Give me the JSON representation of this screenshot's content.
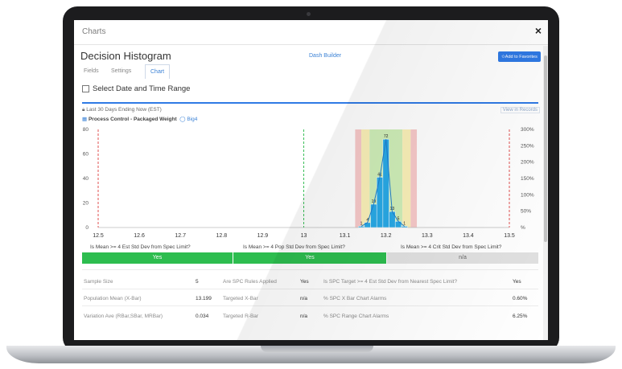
{
  "modal": {
    "title": "Charts",
    "close": "×"
  },
  "page": {
    "title": "Decision Histogram",
    "dash_builder": "Dash Builder",
    "favorites": "✩Add to Favorites"
  },
  "tabs": [
    {
      "label": "Fields"
    },
    {
      "label": "Settings"
    },
    {
      "label": "Chart"
    }
  ],
  "date_range": {
    "label": "Select Date and Time Range"
  },
  "meta": {
    "range": "Last 30 Days Ending Now (EST)",
    "source": "Process Control - Packaged Weight",
    "tag": "Big4",
    "view_records": "View in Records"
  },
  "chart_data": {
    "type": "bar",
    "x_ticks": [
      "12.5",
      "12.6",
      "12.7",
      "12.8",
      "12.9",
      "13",
      "13.1",
      "13.2",
      "13.3",
      "13.4",
      "13.5"
    ],
    "x_range": [
      12.5,
      13.5
    ],
    "y_left_ticks": [
      "0",
      "20",
      "40",
      "60",
      "80"
    ],
    "y_left_range": [
      0,
      80
    ],
    "y_right_ticks": [
      "%",
      "50%",
      "100%",
      "150%",
      "200%",
      "250%",
      "300%"
    ],
    "bars": [
      {
        "x": 13.14,
        "value": 1
      },
      {
        "x": 13.155,
        "value": 4
      },
      {
        "x": 13.17,
        "value": 19
      },
      {
        "x": 13.185,
        "value": 41
      },
      {
        "x": 13.2,
        "value": 72
      },
      {
        "x": 13.215,
        "value": 13
      },
      {
        "x": 13.23,
        "value": 5
      },
      {
        "x": 13.245,
        "value": 1
      }
    ],
    "bar_color": "#29a9e6",
    "curve_color": "#1f7fd0",
    "red_lines": [
      12.5,
      13.5
    ],
    "green_line": 13.0,
    "zone_red": "#f7c9c9",
    "zone_yellow": "#faf0b8",
    "zone_green": "#cfeeb8"
  },
  "questions": [
    {
      "text": "Is Mean >= 4 Est Std Dev from Spec Limit?",
      "answer": "Yes"
    },
    {
      "text": "Is Mean >= 4 Pop Std Dev from Spec Limit?",
      "answer": "Yes"
    },
    {
      "text": "Is Mean >= 4 Crit Std Dev from Spec Limit?",
      "answer": "n/a"
    }
  ],
  "stats": [
    {
      "l1": "Sample Size",
      "v1": "5",
      "l2": "Are SPC Rules Applied",
      "v2": "Yes",
      "l3": "Is SPC Target >= 4 Est Std Dev from Nearest Spec Limit?",
      "v3": "Yes"
    },
    {
      "l1": "Population Mean (X-Bar)",
      "v1": "13.199",
      "l2": "Targeted X-Bar",
      "v2": "n/a",
      "l3": "% SPC X Bar Chart Alarms",
      "v3": "0.60%"
    },
    {
      "l1": "Variation Ave (RBar,SBar, MRBar)",
      "v1": "0.034",
      "l2": "Targeted R-Bar",
      "v2": "n/a",
      "l3": "% SPC Range Chart Alarms",
      "v3": "6.25%"
    }
  ]
}
